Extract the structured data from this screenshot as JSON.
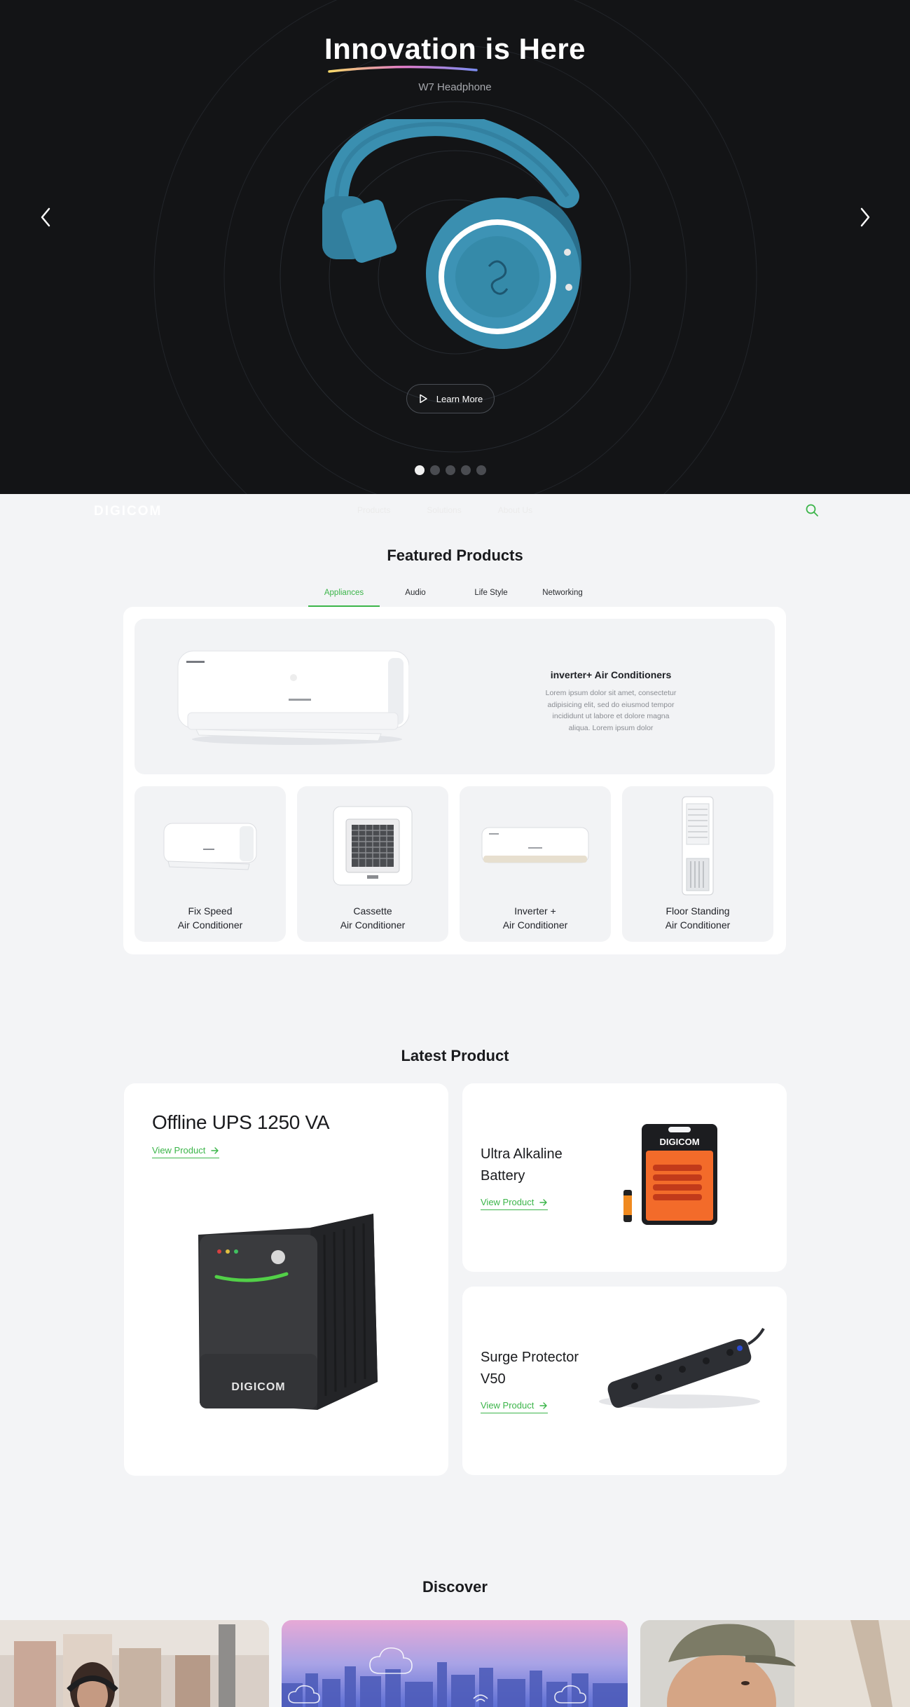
{
  "hero": {
    "title": "Innovation is Here",
    "subtitle": "W7 Headphone",
    "learn_more": "Learn More",
    "slides": 5,
    "active_slide": 1
  },
  "nav": {
    "logo": "DIGICOM",
    "links": [
      "Products",
      "Solutions",
      "About Us"
    ]
  },
  "featured": {
    "title": "Featured Products",
    "tabs": [
      "Appliances",
      "Audio",
      "Life Style",
      "Networking"
    ],
    "active_tab": "Appliances",
    "hero_product": {
      "name": "inverter+ Air Conditioners",
      "description": "Lorem ipsum dolor sit amet, consectetur adipisicing elit, sed do eiusmod tempor incididunt ut labore et dolore magna aliqua. Lorem ipsum dolor"
    },
    "cards": [
      {
        "line1": "Fix Speed",
        "line2": "Air Conditioner"
      },
      {
        "line1": "Cassette",
        "line2": "Air Conditioner"
      },
      {
        "line1": "Inverter +",
        "line2": "Air Conditioner"
      },
      {
        "line1": "Floor Standing",
        "line2": "Air Conditioner"
      }
    ]
  },
  "latest": {
    "title": "Latest Product",
    "view_label": "View Product",
    "items": [
      {
        "name": "Offline UPS 1250 VA"
      },
      {
        "name": "Ultra Alkaline Battery"
      },
      {
        "name": "Surge Protector V50"
      }
    ],
    "product_brand": "DIGICOM"
  },
  "discover": {
    "title": "Discover"
  },
  "colors": {
    "accent": "#3cb54a",
    "hero_bg": "#131416",
    "page_bg": "#f3f4f6",
    "headphone": "#3a8fb0"
  }
}
